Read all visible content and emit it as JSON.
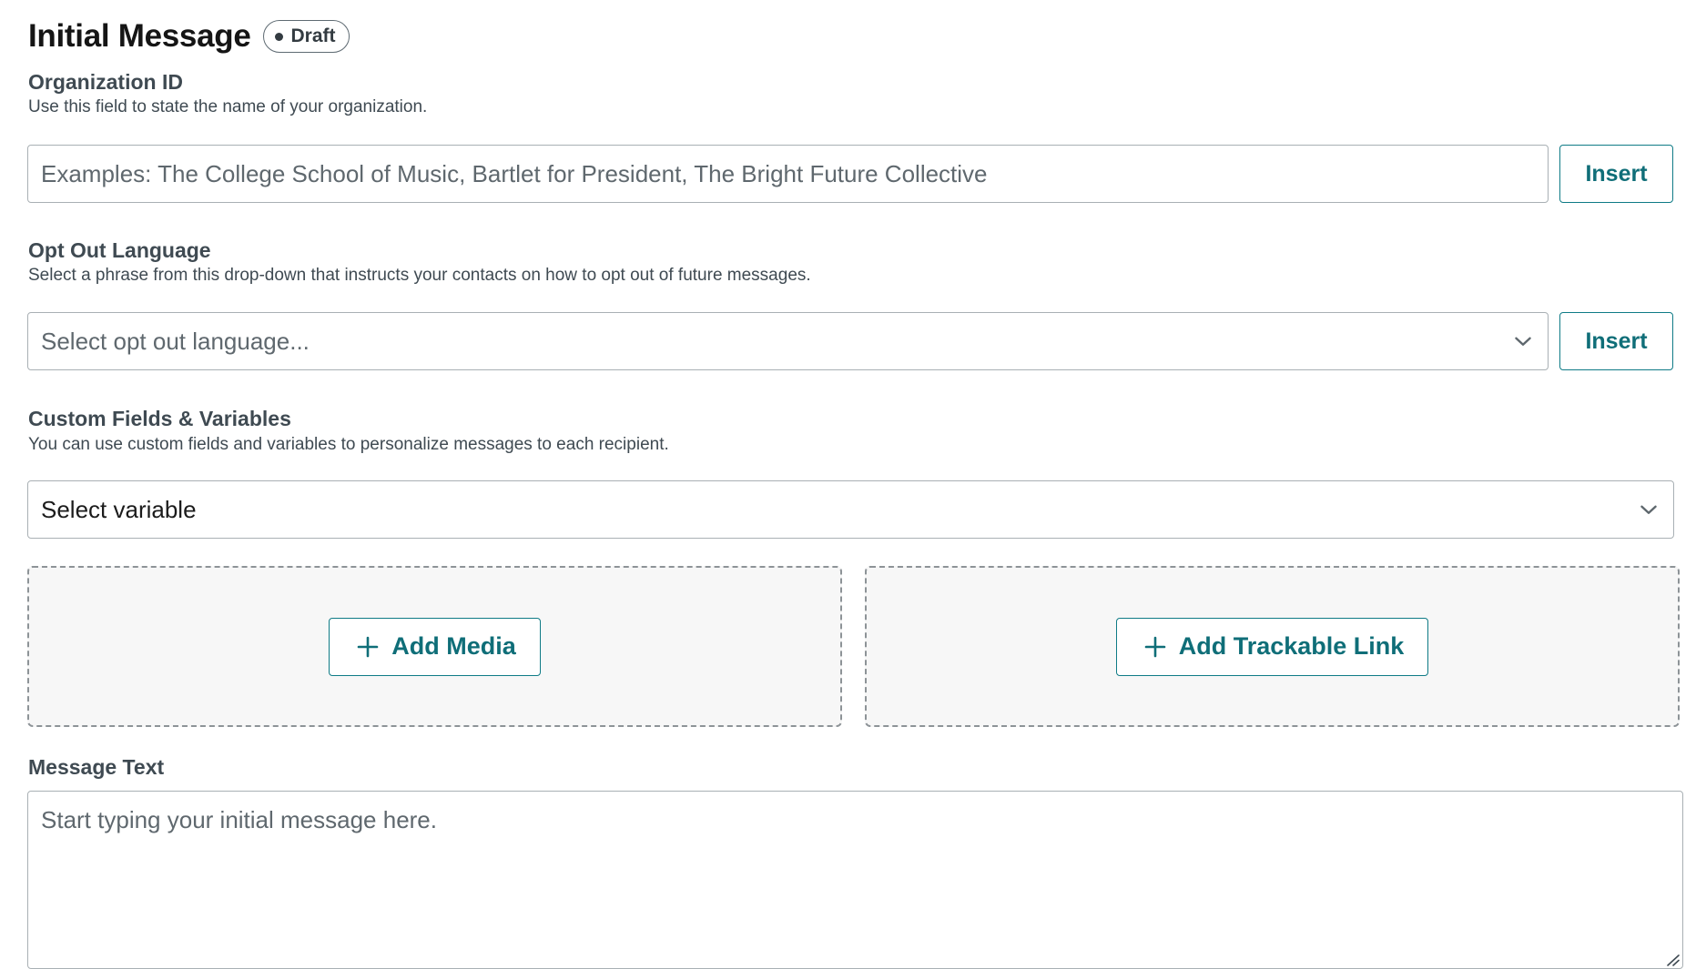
{
  "header": {
    "title": "Initial Message",
    "status": "Draft"
  },
  "organization_id": {
    "label": "Organization ID",
    "help": "Use this field to state the name of your organization.",
    "placeholder": "Examples: The College School of Music, Bartlet for President, The Bright Future Collective",
    "value": "",
    "insert_label": "Insert"
  },
  "opt_out": {
    "label": "Opt Out Language",
    "help": "Select a phrase from this drop-down that instructs your contacts on how to opt out of future messages.",
    "placeholder": "Select opt out language...",
    "insert_label": "Insert",
    "icon": "chevron-down-icon"
  },
  "custom_fields": {
    "label": "Custom Fields & Variables",
    "help": "You can use custom fields and variables to personalize messages to each recipient.",
    "selected": "Select variable",
    "icon": "chevron-down-icon"
  },
  "media": {
    "add_media_label": "Add Media",
    "add_link_label": "Add Trackable Link",
    "icon": "plus-icon"
  },
  "message_text": {
    "label": "Message Text",
    "placeholder": "Start typing your initial message here.",
    "value": ""
  },
  "colors": {
    "accent": "#0f6e78",
    "text": "#1b1b1b",
    "muted_text": "#3f4a52",
    "border": "#a9b0b4",
    "dropzone_bg": "#f7f7f7"
  }
}
